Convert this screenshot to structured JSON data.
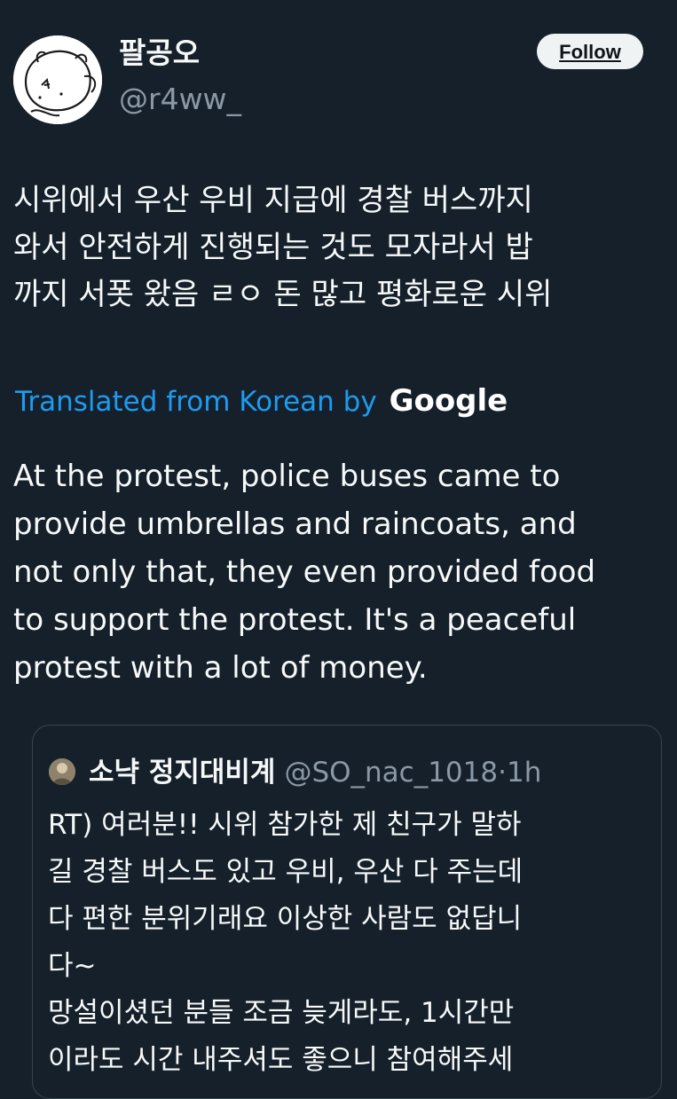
{
  "tweet": {
    "author_name": "팔공오",
    "author_handle": "@r4ww_",
    "follow_label": "Follow",
    "text": "시위에서 우산 우비 지급에 경찰 버스까지\n와서 안전하게 진행되는 것도 모자라서 밥\n까지 서폿 왔음 ㄹㅇ 돈 많고 평화로운 시위",
    "translated_label": "Translated from Korean by",
    "translated_provider": "Google",
    "translation": "At the protest, police buses came to\nprovide umbrellas and raincoats, and\nnot only that, they even provided food\nto support the protest. It's a peaceful\nprotest with a lot of money."
  },
  "quote": {
    "author_name": "소냑 정지대비계",
    "author_handle": "@SO_nac_1018",
    "separator": "·",
    "time": "1h",
    "text": "RT) 여러분!! 시위 참가한 제 친구가 말하\n길 경찰 버스도 있고 우비, 우산 다 주는데\n다 편한 분위기래요 이상한 사람도 없답니\n다~\n망설이셨던 분들 조금 늦게라도, 1시간만\n이라도 시간 내주셔도 좋으니 참여해주세"
  },
  "colors": {
    "background": "#15202b",
    "text_primary": "#f7f9f9",
    "text_secondary": "#8b98a5",
    "link": "#1d9bf0",
    "border": "#38444d",
    "follow_bg": "#eff3f4"
  }
}
